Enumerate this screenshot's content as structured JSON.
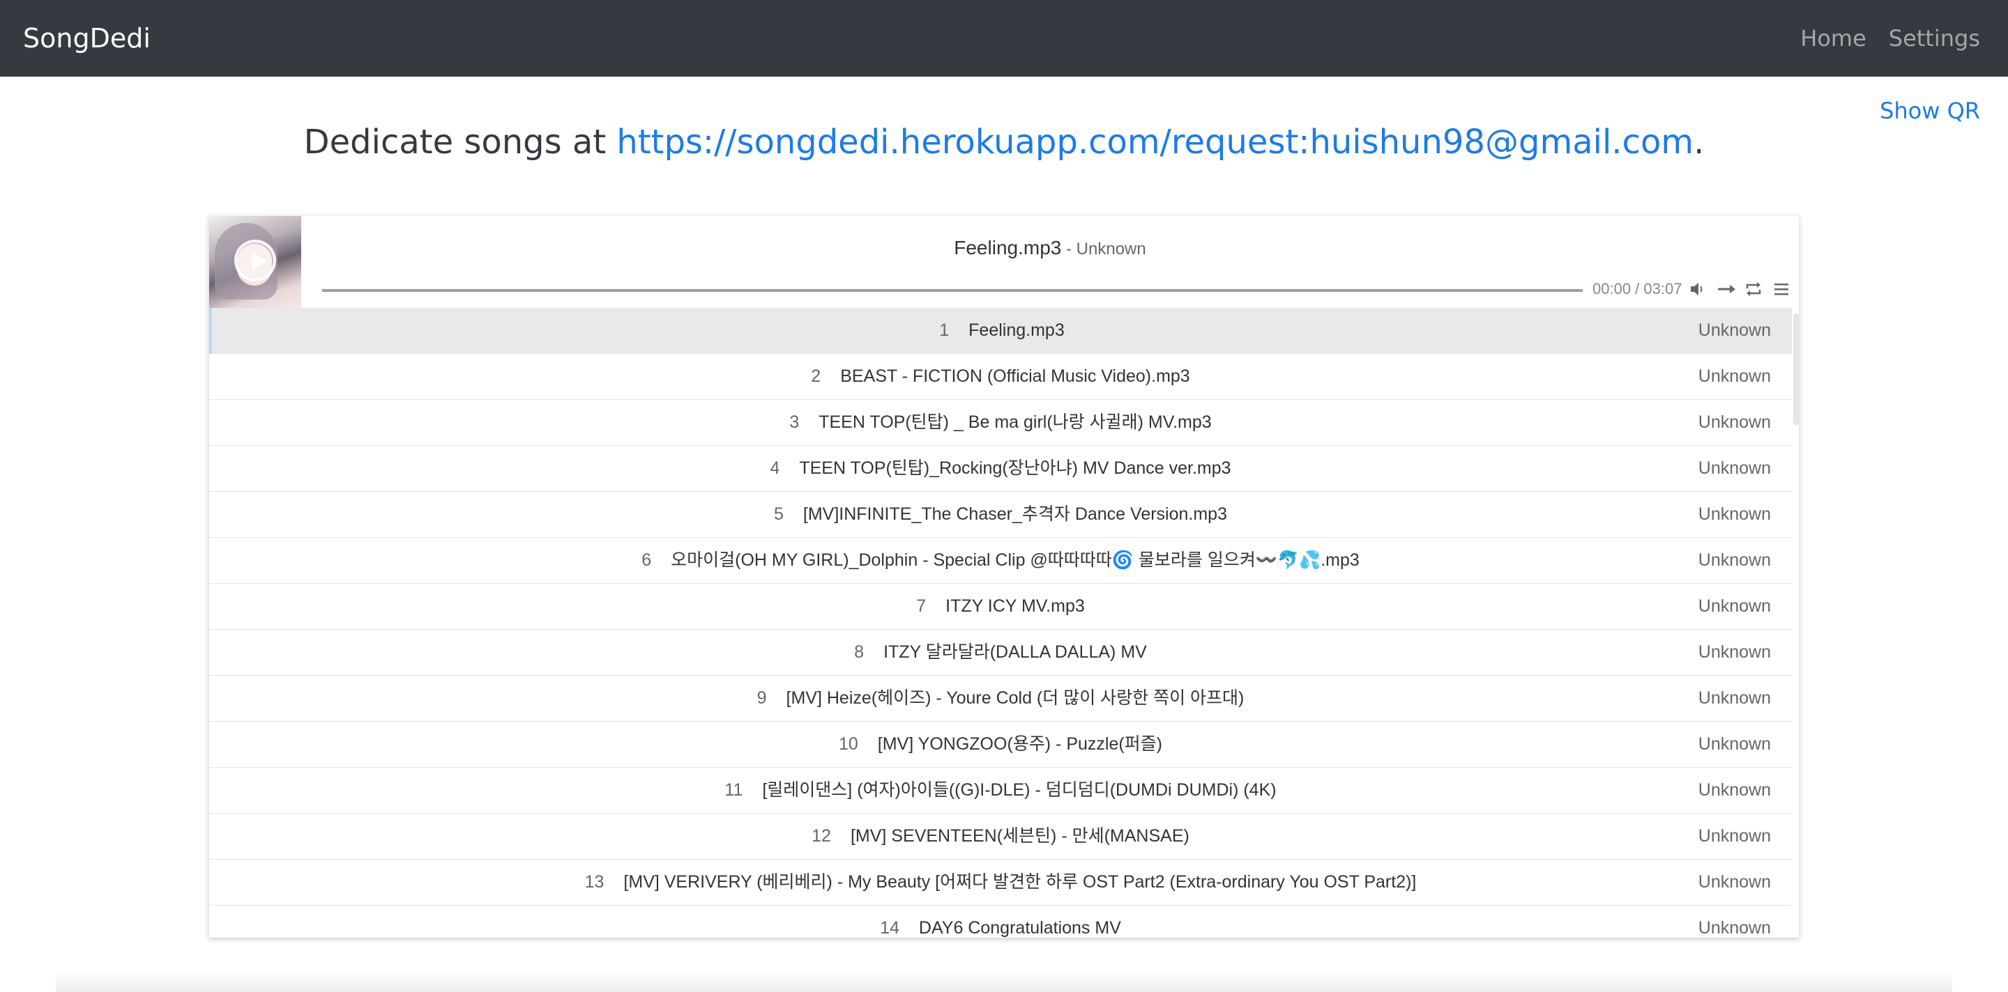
{
  "navbar": {
    "brand": "SongDedi",
    "links": [
      "Home",
      "Settings"
    ]
  },
  "show_qr": "Show QR",
  "headline": {
    "prefix": "Dedicate songs at ",
    "link": "https://songdedi.herokuapp.com/request:huishun98@gmail.com",
    "suffix": "."
  },
  "player": {
    "title": "Feeling.mp3",
    "author": " - Unknown",
    "time": "00:00 / 03:07",
    "controls": [
      "volume-icon",
      "order-icon",
      "loop-icon",
      "menu-icon"
    ]
  },
  "playlist": [
    {
      "num": "1",
      "title": "Feeling.mp3",
      "author": "Unknown"
    },
    {
      "num": "2",
      "title": "BEAST - FICTION (Official Music Video).mp3",
      "author": "Unknown"
    },
    {
      "num": "3",
      "title": "TEEN TOP(틴탑) _ Be ma girl(나랑 사귈래) MV.mp3",
      "author": "Unknown"
    },
    {
      "num": "4",
      "title": "TEEN TOP(틴탑)_Rocking(장난아냐) MV Dance ver.mp3",
      "author": "Unknown"
    },
    {
      "num": "5",
      "title": "[MV]INFINITE_The Chaser_추격자 Dance Version.mp3",
      "author": "Unknown"
    },
    {
      "num": "6",
      "title": "오마이걸(OH MY GIRL)_Dolphin - Special Clip @따따따따🌀 물보라를 일으켜〰️🐬💦.mp3",
      "author": "Unknown"
    },
    {
      "num": "7",
      "title": "ITZY ICY MV.mp3",
      "author": "Unknown"
    },
    {
      "num": "8",
      "title": "ITZY 달라달라(DALLA DALLA) MV",
      "author": "Unknown"
    },
    {
      "num": "9",
      "title": "[MV] Heize(헤이즈) - Youre Cold (더 많이 사랑한 쪽이 아프대)",
      "author": "Unknown"
    },
    {
      "num": "10",
      "title": "[MV] YONGZOO(용주) - Puzzle(퍼즐)",
      "author": "Unknown"
    },
    {
      "num": "11",
      "title": "[릴레이댄스] (여자)아이들((G)I-DLE) - 덤디덤디(DUMDi DUMDi) (4K)",
      "author": "Unknown"
    },
    {
      "num": "12",
      "title": "[MV] SEVENTEEN(세븐틴) - 만세(MANSAE)",
      "author": "Unknown"
    },
    {
      "num": "13",
      "title": "[MV] VERIVERY (베리베리) - My Beauty [어쩌다 발견한 하루 OST Part2 (Extra-ordinary You OST Part2)]",
      "author": "Unknown"
    },
    {
      "num": "14",
      "title": "DAY6 Congratulations MV",
      "author": "Unknown"
    }
  ]
}
